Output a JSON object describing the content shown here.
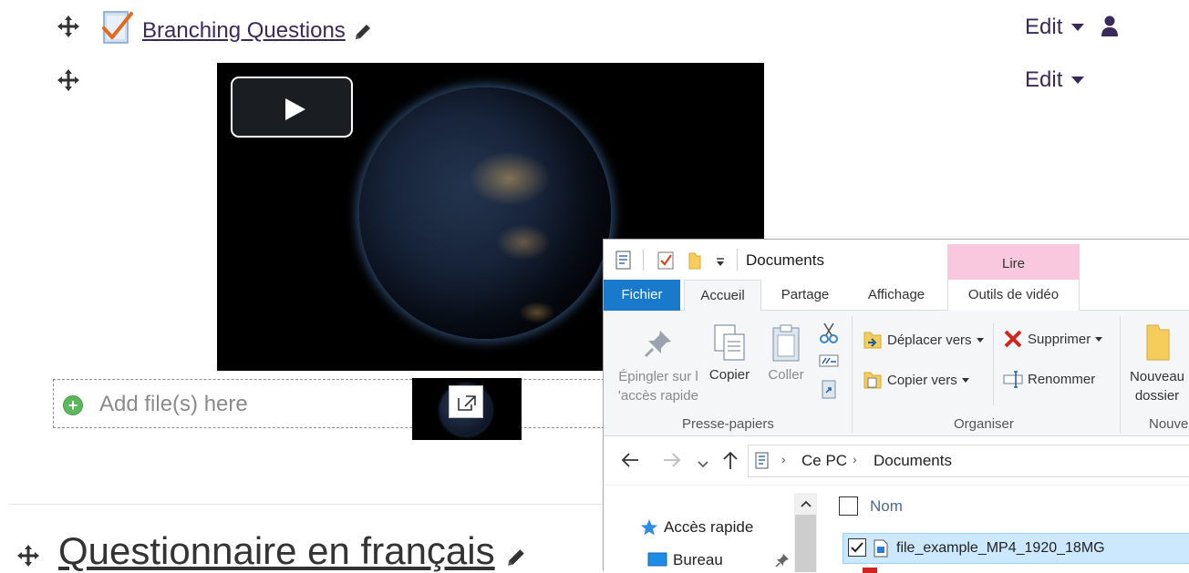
{
  "activity1": {
    "title": "Branching Questions",
    "edit_label": "Edit"
  },
  "activity2": {
    "edit_label": "Edit"
  },
  "dropzone": {
    "label": "Add file(s) here"
  },
  "section": {
    "title": "Questionnaire en français"
  },
  "explorer": {
    "window_title": "Documents",
    "contextual_tab": "Lire",
    "tabs": [
      "Fichier",
      "Accueil",
      "Partage",
      "Affichage",
      "Outils de vidéo"
    ],
    "ribbon": {
      "pin_label": "Épingler sur l 'accès rapide",
      "copy_label": "Copier",
      "paste_label": "Coller",
      "group_clipboard": "Presse-papiers",
      "move_to": "Déplacer vers",
      "copy_to": "Copier vers",
      "delete": "Supprimer",
      "rename": "Renommer",
      "group_organize": "Organiser",
      "new_folder": "Nouveau dossier",
      "group_new": "Nouve"
    },
    "address": {
      "root": "Ce PC",
      "folder": "Documents"
    },
    "nav": {
      "quick_access": "Accès rapide",
      "desktop": "Bureau"
    },
    "files": {
      "column_name": "Nom",
      "selected_file": "file_example_MP4_1920_18MG"
    },
    "accent": "#1979ca"
  }
}
